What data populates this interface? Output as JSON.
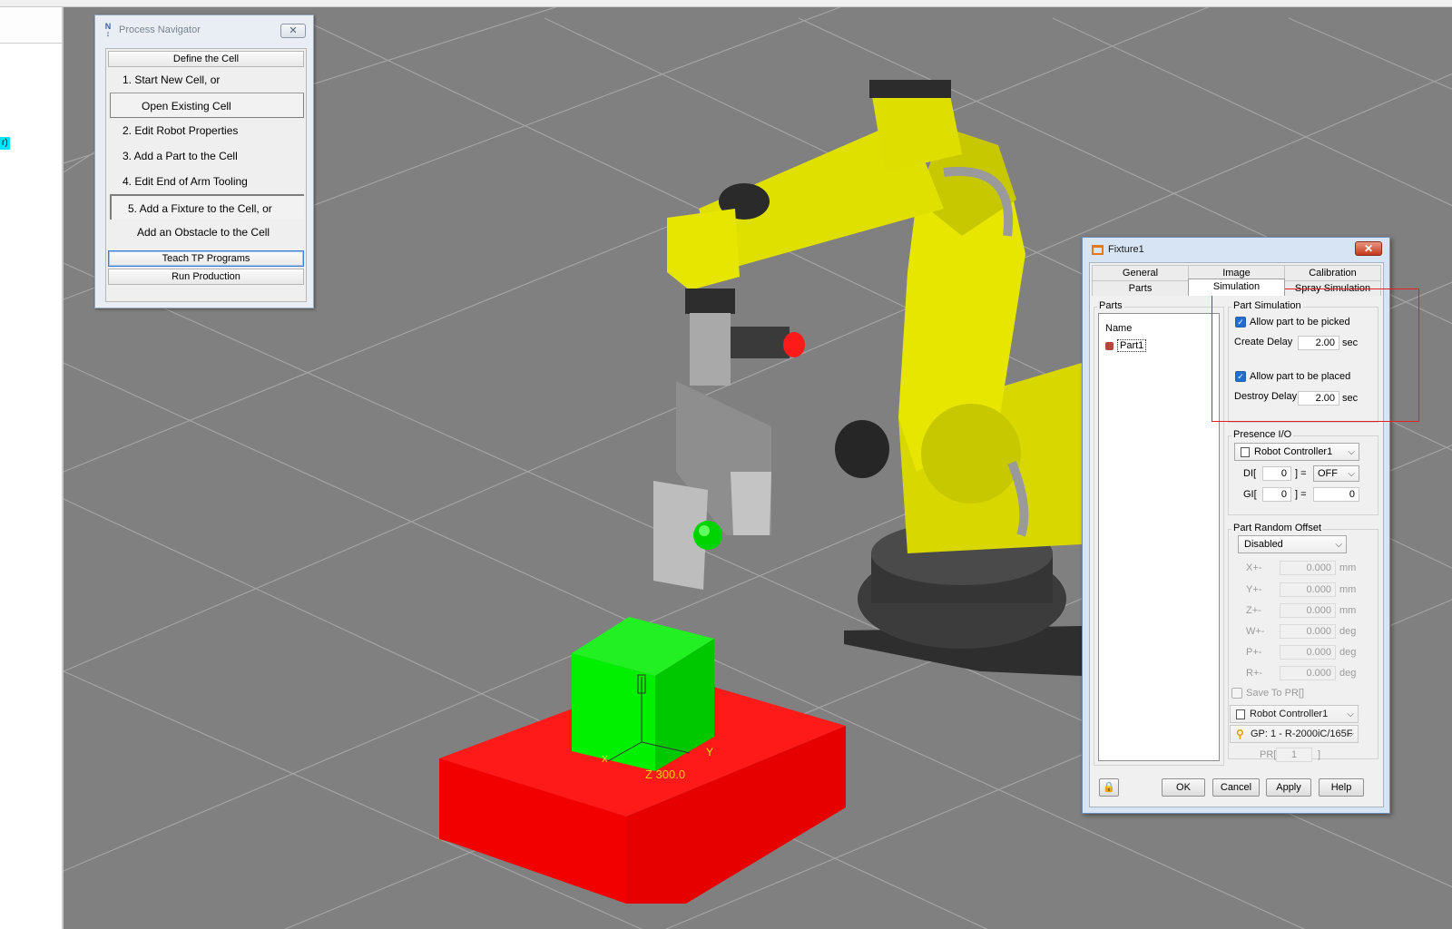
{
  "left_pane": {
    "highlight_text": "r)"
  },
  "navigator": {
    "title": "Process Navigator",
    "close_glyph": "✕",
    "define_cell": "Define the Cell",
    "steps": [
      "1.  Start New Cell, or",
      "Open Existing Cell",
      "2.  Edit Robot Properties",
      "3.  Add a Part to the Cell",
      "4.  Edit End of Arm Tooling",
      "5.  Add a Fixture to the Cell, or",
      "Add an Obstacle to the Cell"
    ],
    "teach": "Teach TP Programs",
    "run": "Run Production"
  },
  "scene": {
    "dimension_label": "Z 300.0",
    "axis_x": "X",
    "axis_y": "Y"
  },
  "fixture": {
    "title": "Fixture1",
    "close_glyph": "✕",
    "tabs_row1": [
      "General",
      "Image",
      "Calibration"
    ],
    "tabs_row2": [
      "Parts",
      "Simulation",
      "Spray Simulation"
    ],
    "parts_group": "Parts",
    "parts_col": "Name",
    "parts": [
      "Part1"
    ],
    "part_sim_group": "Part Simulation",
    "allow_pick": "Allow part to be picked",
    "create_delay_label": "Create Delay",
    "create_delay": "2.00",
    "allow_place": "Allow part to be placed",
    "destroy_delay_label": "Destroy Delay",
    "destroy_delay": "2.00",
    "sec": "sec",
    "presence_group": "Presence I/O",
    "presence_controller": "Robot Controller1",
    "di_label": "DI[",
    "di_index": "0",
    "di_eq": "] =",
    "di_value": "OFF",
    "gi_label": "GI[",
    "gi_index": "0",
    "gi_eq": "] =",
    "gi_value": "0",
    "offset_group": "Part Random Offset",
    "offset_mode": "Disabled",
    "offsets": [
      {
        "label": "X+-",
        "value": "0.000",
        "unit": "mm"
      },
      {
        "label": "Y+-",
        "value": "0.000",
        "unit": "mm"
      },
      {
        "label": "Z+-",
        "value": "0.000",
        "unit": "mm"
      },
      {
        "label": "W+-",
        "value": "0.000",
        "unit": "deg"
      },
      {
        "label": "P+-",
        "value": "0.000",
        "unit": "deg"
      },
      {
        "label": "R+-",
        "value": "0.000",
        "unit": "deg"
      }
    ],
    "save_pr": "Save To PR[]",
    "pr_controller": "Robot Controller1",
    "pr_group": "GP: 1 - R-2000iC/165F",
    "pr_label": "PR[",
    "pr_index": "1",
    "pr_close": "]",
    "buttons": {
      "ok": "OK",
      "cancel": "Cancel",
      "apply": "Apply",
      "help": "Help"
    }
  },
  "colors": {
    "viewport_bg": "#808080",
    "robot_yellow": "#e6e600",
    "fixture_red": "#ff0000",
    "part_green": "#00e600",
    "highlight_box": "#e02020"
  }
}
